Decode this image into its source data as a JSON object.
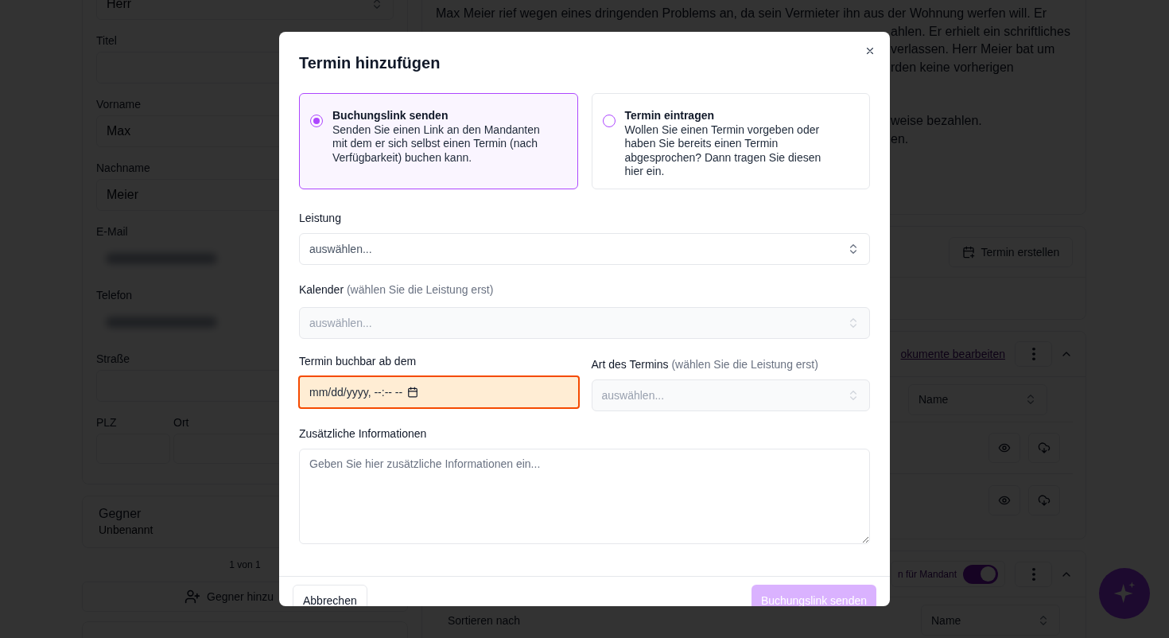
{
  "background": {
    "client_form": {
      "salutation": "Herr",
      "fields": [
        {
          "label": "Titel",
          "blurred": false
        },
        {
          "label": "Vorname",
          "value": "Max",
          "blurred": false
        },
        {
          "label": "Nachname",
          "value": "Meier",
          "blurred": false
        },
        {
          "label": "E-Mail",
          "blurred": true
        },
        {
          "label": "Telefon",
          "blurred": true
        },
        {
          "label": "Straße",
          "blurred": false
        }
      ],
      "postal_code": {
        "label": "PLZ"
      },
      "city": {
        "label": "Ort"
      }
    },
    "opponent": {
      "title": "Gegner",
      "subtitle": "Unbenannt",
      "pager": "1 von 1",
      "add_button": "Gegner hinzu"
    },
    "notes": {
      "lines": [
        "Max Meier rief wegen eines dringenden Problems an, da sein Vermieter ihn aus der Wohnung werfen will. Er"
      ],
      "fragments": [
        {
          "lines": [
            "ahlen. Er erhielt ein schriftliches",
            "verlassen. Herr Meier bat um",
            "rden keine vorherigen"
          ]
        },
        {
          "lines": [
            "weise bezahlen.",
            "en."
          ]
        }
      ]
    },
    "appointments": {
      "button": "Termin erstellen"
    },
    "documents": {
      "link": "okumente bearbeiten",
      "sort_value": "Name"
    },
    "client_documents": {
      "toggle_label": "n für Mandant",
      "toggle_on": true,
      "sort_label": "Sortieren nach",
      "sort_value": "Name"
    }
  },
  "modal": {
    "title": "Termin hinzufügen",
    "options": [
      {
        "title": "Buchungslink senden",
        "description": "Senden Sie einen Link an den Mandanten mit dem er sich selbst einen Termin (nach Verfügbarkeit) buchen kann.",
        "selected": true
      },
      {
        "title": "Termin eintragen",
        "description": "Wollen Sie einen Termin vorgeben oder haben Sie bereits einen Termin abgesprochen? Dann tragen Sie diesen hier ein.",
        "selected": false
      }
    ],
    "service": {
      "label": "Leistung",
      "placeholder": "auswählen...",
      "disabled": false
    },
    "calendar": {
      "label": "Kalender",
      "hint": "(wählen Sie die Leistung erst)",
      "placeholder": "auswählen...",
      "disabled": true
    },
    "start": {
      "label": "Termin buchbar ab dem",
      "placeholder": "mm/dd/yyyy, --:-- --",
      "highlighted": true
    },
    "type": {
      "label": "Art des Termins",
      "hint": "(wählen Sie die Leistung erst)",
      "placeholder": "auswählen...",
      "disabled": true
    },
    "info": {
      "label": "Zusätzliche Informationen",
      "placeholder": "Geben Sie hier zusätzliche Informationen ein..."
    },
    "cancel_button": "Abbrechen",
    "submit_button": {
      "label": "Buchungslink senden",
      "disabled": true
    }
  }
}
